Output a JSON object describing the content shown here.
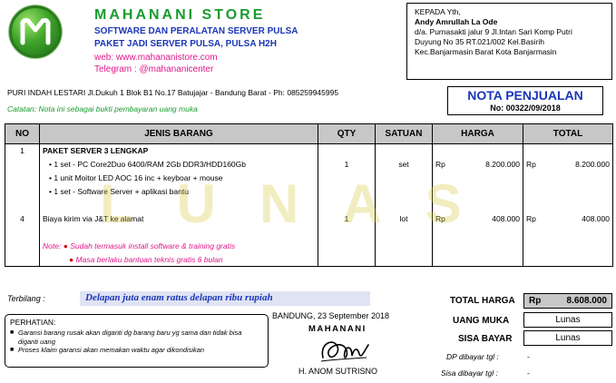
{
  "header": {
    "store_name": "MAHANANI STORE",
    "tagline_1": "SOFTWARE DAN PERALATAN SERVER PULSA",
    "tagline_2": "PAKET JADI SERVER PULSA, PULSA H2H",
    "web": "web: www.mahananistore.com",
    "telegram": "Telegram : @mahananicenter",
    "address": "PURI INDAH LESTARI Jl.Dukuh 1 Blok B1 No.17 Batujajar  - Bandung Barat - Ph: 085259945995",
    "note": "Catatan: Nota ini sebagai bukti pembayaran uang muka"
  },
  "recipient": {
    "label": "KEPADA Yth,",
    "name": "Andy Amrullah La Ode",
    "line_1": "d/a. Purnasakti jalur 9 Jl.Intan Sari Komp Putri",
    "line_2": "Duyung No 35 RT.021/002 Kel.Basirih",
    "line_3": "Kec.Banjarmasin Barat Kota Banjarmasin"
  },
  "invoice": {
    "title": "NOTA PENJUALAN",
    "number": "No: 00322/09/2018"
  },
  "table": {
    "headers": [
      "NO",
      "JENIS BARANG",
      "QTY",
      "SATUAN",
      "HARGA",
      "TOTAL"
    ],
    "rows": [
      {
        "no": "1",
        "desc": "PAKET SERVER 3 LENGKAP",
        "qty": "",
        "unit": "",
        "price_cur": "",
        "price": "",
        "total_cur": "",
        "total": ""
      },
      {
        "no": "",
        "desc": "• 1 set - PC Core2Duo 6400/RAM 2Gb DDR3/HDD160Gb",
        "qty": "1",
        "unit": "set",
        "price_cur": "Rp",
        "price": "8.200.000",
        "total_cur": "Rp",
        "total": "8.200.000"
      },
      {
        "no": "",
        "desc": "• 1 unit Moitor LED AOC 16 inc + keyboar + mouse",
        "qty": "",
        "unit": "",
        "price_cur": "",
        "price": "",
        "total_cur": "",
        "total": ""
      },
      {
        "no": "",
        "desc": "• 1 set - Software Server + aplikasi bantu",
        "qty": "",
        "unit": "",
        "price_cur": "",
        "price": "",
        "total_cur": "",
        "total": ""
      },
      {
        "no": "",
        "desc": "",
        "qty": "",
        "unit": "",
        "price_cur": "",
        "price": "",
        "total_cur": "",
        "total": ""
      },
      {
        "no": "4",
        "desc": "Biaya kirim via J&T ke alamat",
        "qty": "1",
        "unit": "lot",
        "price_cur": "Rp",
        "price": "408.000",
        "total_cur": "Rp",
        "total": "408.000"
      },
      {
        "no": "",
        "desc": "",
        "qty": "",
        "unit": "",
        "price_cur": "",
        "price": "",
        "total_cur": "",
        "total": ""
      }
    ],
    "note_label": "Note:",
    "note_1": "Sudah termasuk install software & training gratis",
    "note_2": "Masa berlaku bantuan teknis gratis 6 bulan"
  },
  "watermark": "LUNAS",
  "terbilang": {
    "label": "Terbilang :",
    "text": "Delapan juta enam ratus delapan ribu rupiah"
  },
  "perhatian": {
    "title": "PERHATIAN:",
    "item_1": "Garansi barang rusak akan diganti dg barang baru yg sama dan tidak bisa diganti uang",
    "item_2": "Proses klaim garansi akan memakan waktu agar dikondisikan"
  },
  "signature": {
    "date": "BANDUNG, 23 September 2018",
    "company": "MAHANANI",
    "name": "H. ANOM SUTRISNO"
  },
  "totals": {
    "grand_label": "TOTAL HARGA",
    "grand_currency": "Rp",
    "grand_value": "8.608.000",
    "dp_label": "UANG MUKA",
    "dp_value": "Lunas",
    "sisa_label": "SISA BAYAR",
    "sisa_value": "Lunas",
    "dp_date_label": "DP dibayar tgl :",
    "dp_date_value": "-",
    "sisa_date_label": "Sisa dibayar tgl :",
    "sisa_date_value": "-"
  },
  "colors": {
    "brand_green": "#1a9b2e",
    "brand_blue": "#1a36b8",
    "accent_pink": "#e0188a",
    "header_gray": "#c7c7c7"
  }
}
